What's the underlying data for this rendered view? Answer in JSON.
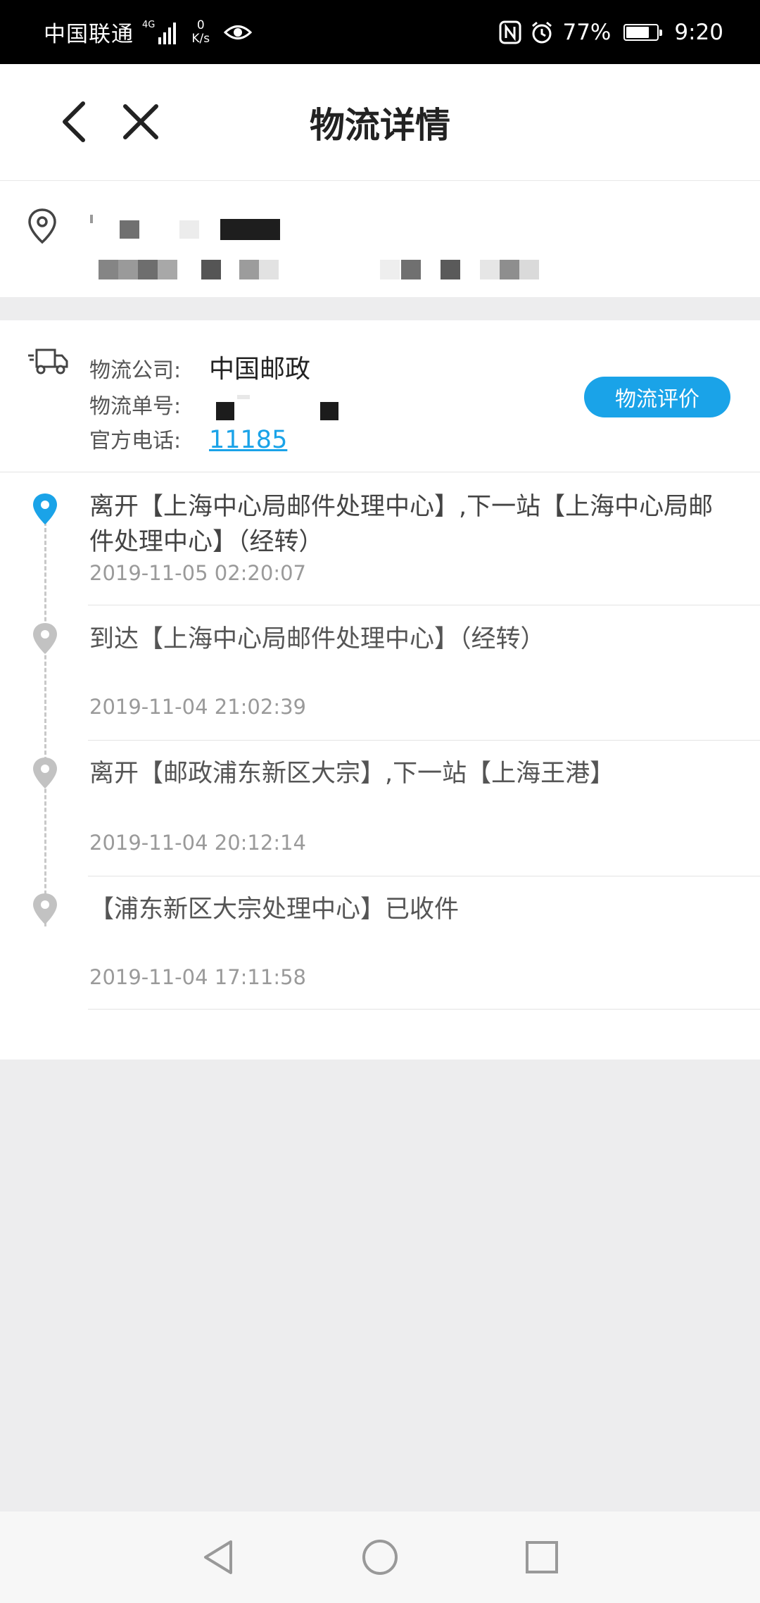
{
  "status_bar": {
    "carrier": "中国联通",
    "network_tag": "4G",
    "speed_value": "0",
    "speed_unit": "K/s",
    "battery": "77%",
    "time": "9:20"
  },
  "header": {
    "title": "物流详情"
  },
  "logistics": {
    "company_label": "物流公司:",
    "company": "中国邮政",
    "tracking_label": "物流单号:",
    "phone_label": "官方电话:",
    "phone": "11185",
    "rate_button": "物流评价"
  },
  "events": [
    {
      "desc": "离开【上海中心局邮件处理中心】,下一站【上海中心局邮件处理中心】（经转）",
      "time": "2019-11-05 02:20:07",
      "active": true
    },
    {
      "desc": "到达【上海中心局邮件处理中心】（经转）",
      "time": "2019-11-04 21:02:39",
      "active": false
    },
    {
      "desc": "离开【邮政浦东新区大宗】,下一站【上海王港】",
      "time": "2019-11-04 20:12:14",
      "active": false
    },
    {
      "desc": "【浦东新区大宗处理中心】已收件",
      "time": "2019-11-04 17:11:58",
      "active": false
    }
  ],
  "colors": {
    "accent": "#1aa3e8",
    "pin_inactive": "#c2c2c2",
    "background": "#ededee"
  }
}
